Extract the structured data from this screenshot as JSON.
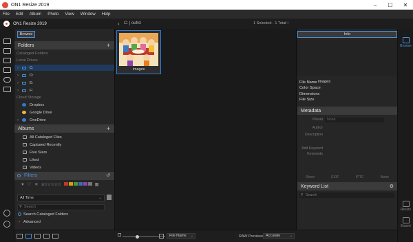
{
  "app": {
    "window_title": "ON1 Resize 2019",
    "app_name": "ON1 Resize 2019",
    "window_controls": {
      "minimize": "–",
      "maximize": "☐",
      "close": "✕"
    }
  },
  "menu": [
    "File",
    "Edit",
    "Album",
    "Photo",
    "View",
    "Window",
    "Help"
  ],
  "toolbar": {
    "back_glyph": "‹",
    "path": "C: | oufrd",
    "selection_count": "1 Selected - 1 Total",
    "nav_arrows": "‹  ›"
  },
  "left_panel": {
    "browse_tab": "Browse",
    "folders": {
      "header": "Folders",
      "add": "+",
      "cataloged_label": "Cataloged Folders",
      "local_label": "Local Drives",
      "drives": [
        {
          "label": "C:",
          "selected": true
        },
        {
          "label": "D:",
          "selected": false
        },
        {
          "label": "E:",
          "selected": false
        },
        {
          "label": "F:",
          "selected": false
        }
      ],
      "cloud_label": "Cloud Storage",
      "cloud": [
        {
          "label": "Dropbox",
          "color": "#2c78d6"
        },
        {
          "label": "Google Drive",
          "color": "#f2b63c"
        },
        {
          "label": "OneDrive",
          "color": "#3a7fd8"
        }
      ]
    },
    "albums": {
      "header": "Albums",
      "add": "+",
      "items": [
        "All Cataloged Files",
        "Captured Recently",
        "Five Stars",
        "Liked",
        "Videos"
      ]
    },
    "filters": {
      "header": "Filters",
      "stars": "≥☆☆☆☆☆",
      "swatch_colors": [
        "#c0392b",
        "#d4a017",
        "#4a9a3b",
        "#3a6fb5",
        "#8e44ad",
        "#777777"
      ],
      "time_select": "All Time",
      "search_placeholder": "Search",
      "search_cataloged": "Search Cataloged Folders",
      "advanced": "Advanced"
    }
  },
  "grid": {
    "items": [
      {
        "label": "images"
      }
    ]
  },
  "right_panel": {
    "info_tab": "Info",
    "info_fields": [
      "File Name",
      "Color Space",
      "Dimensions",
      "File Size"
    ],
    "file_name": "images",
    "metadata": {
      "header": "Metadata",
      "preset_label": "Preset",
      "preset_value": "None",
      "author_label": "Author",
      "description_label": "Description",
      "add_keyword_label": "Add Keyword",
      "keywords_label": "Keywords",
      "tabs": [
        "Show",
        "EXIF",
        "IPTC",
        "None"
      ]
    },
    "keyword_list": {
      "header": "Keyword List",
      "search_placeholder": "Search"
    }
  },
  "right_rail": {
    "browse": "Browse",
    "resize": "Resize",
    "export": "Export"
  },
  "bottom_bar": {
    "sort_select": "File Name",
    "raw_label": "RAW Previews",
    "raw_select": "Accurate"
  }
}
